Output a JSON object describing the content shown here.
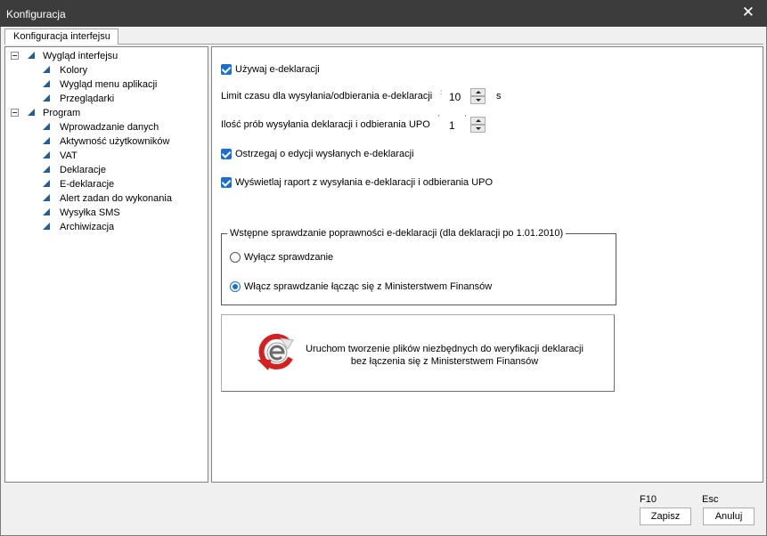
{
  "window": {
    "title": "Konfiguracja",
    "close_glyph": "✕"
  },
  "tabs": [
    {
      "label": "Konfiguracja interfejsu"
    }
  ],
  "tree": {
    "groups": [
      {
        "label": "Wygląd interfejsu",
        "children": [
          "Kolory",
          "Wygląd menu aplikacji",
          "Przeglądarki"
        ]
      },
      {
        "label": "Program",
        "children": [
          "Wprowadzanie danych",
          "Aktywność użytkowników",
          "VAT",
          "Deklaracje",
          "E-deklaracje",
          "Alert zadan do wykonania",
          "Wysyłka SMS",
          "Archiwizacja"
        ]
      }
    ]
  },
  "settings": {
    "use_edeklaracje": {
      "label": "Używaj e-deklaracji",
      "checked": true
    },
    "time_limit": {
      "label": "Limit czasu dla wysyłania/odbierania e-deklaracji",
      "value": "10",
      "unit": "s"
    },
    "attempts": {
      "label": "Ilość prób wysyłania deklaracji i odbierania UPO",
      "value": "1"
    },
    "warn_edit": {
      "label": "Ostrzegaj o edycji wysłanych e-deklaracji",
      "checked": true
    },
    "show_report": {
      "label": "Wyświetlaj raport z wysyłania e-deklaracji i odbierania UPO",
      "checked": true
    }
  },
  "validation": {
    "title": "Wstępne sprawdzanie poprawności e-deklaracji (dla deklaracji po 1.01.2010)",
    "options": [
      {
        "label": "Wyłącz sprawdzanie",
        "selected": false
      },
      {
        "label": "Włącz sprawdzanie łącząc się z Ministerstwem Finansów",
        "selected": true
      }
    ]
  },
  "offline_button": {
    "line1": "Uruchom tworzenie plików niezbędnych do weryfikacji deklaracji",
    "line2": "bez łączenia się z Ministerstwem Finansów",
    "icon": "e-deklaracje-refresh-icon"
  },
  "footer": {
    "save": {
      "hint": "F10",
      "label": "Zapisz"
    },
    "cancel": {
      "hint": "Esc",
      "label": "Anuluj"
    }
  },
  "colors": {
    "accent": "#1a6fd1",
    "tree_marker": "#1f5e96",
    "titlebar": "#3c3c3c",
    "icon_red": "#d42020"
  }
}
